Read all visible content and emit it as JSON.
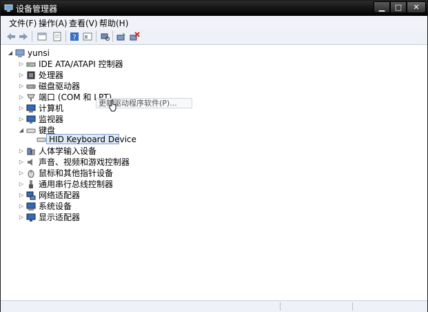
{
  "window": {
    "title": "设备管理器",
    "minimize": "▁",
    "maximize": "□",
    "close": "✕"
  },
  "menu": [
    "文件(F)",
    "操作(A)",
    "查看(V)",
    "帮助(H)"
  ],
  "toolbar_icons": [
    "back-icon",
    "forward-icon",
    "properties-icon",
    "help-icon",
    "view-icon",
    "scan-icon",
    "update-driver-icon",
    "uninstall-icon"
  ],
  "tree": {
    "root": "yunsi",
    "items": [
      {
        "label": "IDE ATA/ATAPI 控制器",
        "icon": "ide-controller-icon",
        "expanded": false
      },
      {
        "label": "处理器",
        "icon": "processor-icon",
        "expanded": false
      },
      {
        "label": "磁盘驱动器",
        "icon": "disk-drive-icon",
        "expanded": false
      },
      {
        "label": "端口 (COM 和 LPT)",
        "icon": "port-icon",
        "expanded": false
      },
      {
        "label": "计算机",
        "icon": "computer-icon",
        "expanded": false
      },
      {
        "label": "监视器",
        "icon": "monitor-icon",
        "expanded": false
      },
      {
        "label": "键盘",
        "icon": "keyboard-icon",
        "expanded": true
      },
      {
        "label": "HID Keyboard Device",
        "icon": "keyboard-device-icon",
        "child": true,
        "selected": true
      },
      {
        "label": "人体学输入设备",
        "icon": "hid-icon",
        "expanded": false
      },
      {
        "label": "声音、视频和游戏控制器",
        "icon": "sound-icon",
        "expanded": false
      },
      {
        "label": "鼠标和其他指针设备",
        "icon": "mouse-icon",
        "expanded": false
      },
      {
        "label": "通用串行总线控制器",
        "icon": "usb-icon",
        "expanded": false
      },
      {
        "label": "网络适配器",
        "icon": "network-icon",
        "expanded": false
      },
      {
        "label": "系统设备",
        "icon": "system-icon",
        "expanded": false
      },
      {
        "label": "显示适配器",
        "icon": "display-icon",
        "expanded": false
      }
    ]
  },
  "context_tooltip": "更新驱动程序软件(P)..."
}
